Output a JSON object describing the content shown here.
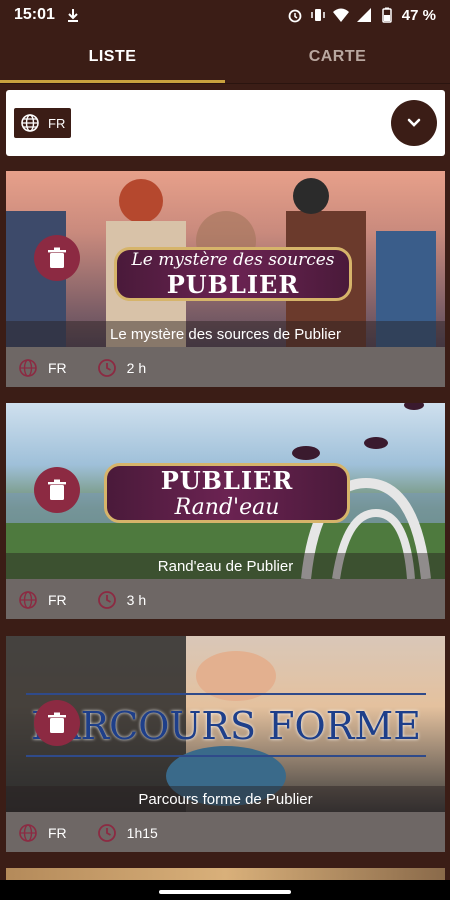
{
  "status": {
    "time": "15:01",
    "battery": "47 %"
  },
  "tabs": [
    {
      "label": "LISTE",
      "active": true
    },
    {
      "label": "CARTE",
      "active": false
    }
  ],
  "filter": {
    "language": "FR"
  },
  "cards": [
    {
      "title": "Le mystère des sources de Publier",
      "banner_line1": "Le mystère des sources",
      "banner_line2": "PUBLIER",
      "language": "FR",
      "duration": "2 h"
    },
    {
      "title": "Rand'eau de Publier",
      "banner_line1": "PUBLIER",
      "banner_line2": "Rand'eau",
      "language": "FR",
      "duration": "3 h"
    },
    {
      "title": "Parcours forme de Publier",
      "banner_line1": "PARCOURS FORME",
      "language": "FR",
      "duration": "1h15"
    }
  ],
  "colors": {
    "background": "#3b1d16",
    "accent": "#c9a23e",
    "delete": "#8c2a42",
    "meta": "#6e6765"
  },
  "icons": [
    "download-icon",
    "alarm-icon",
    "vibrate-icon",
    "wifi-icon",
    "signal-icon",
    "battery-icon",
    "globe-icon",
    "chevron-down-icon",
    "trash-icon",
    "clock-icon"
  ]
}
